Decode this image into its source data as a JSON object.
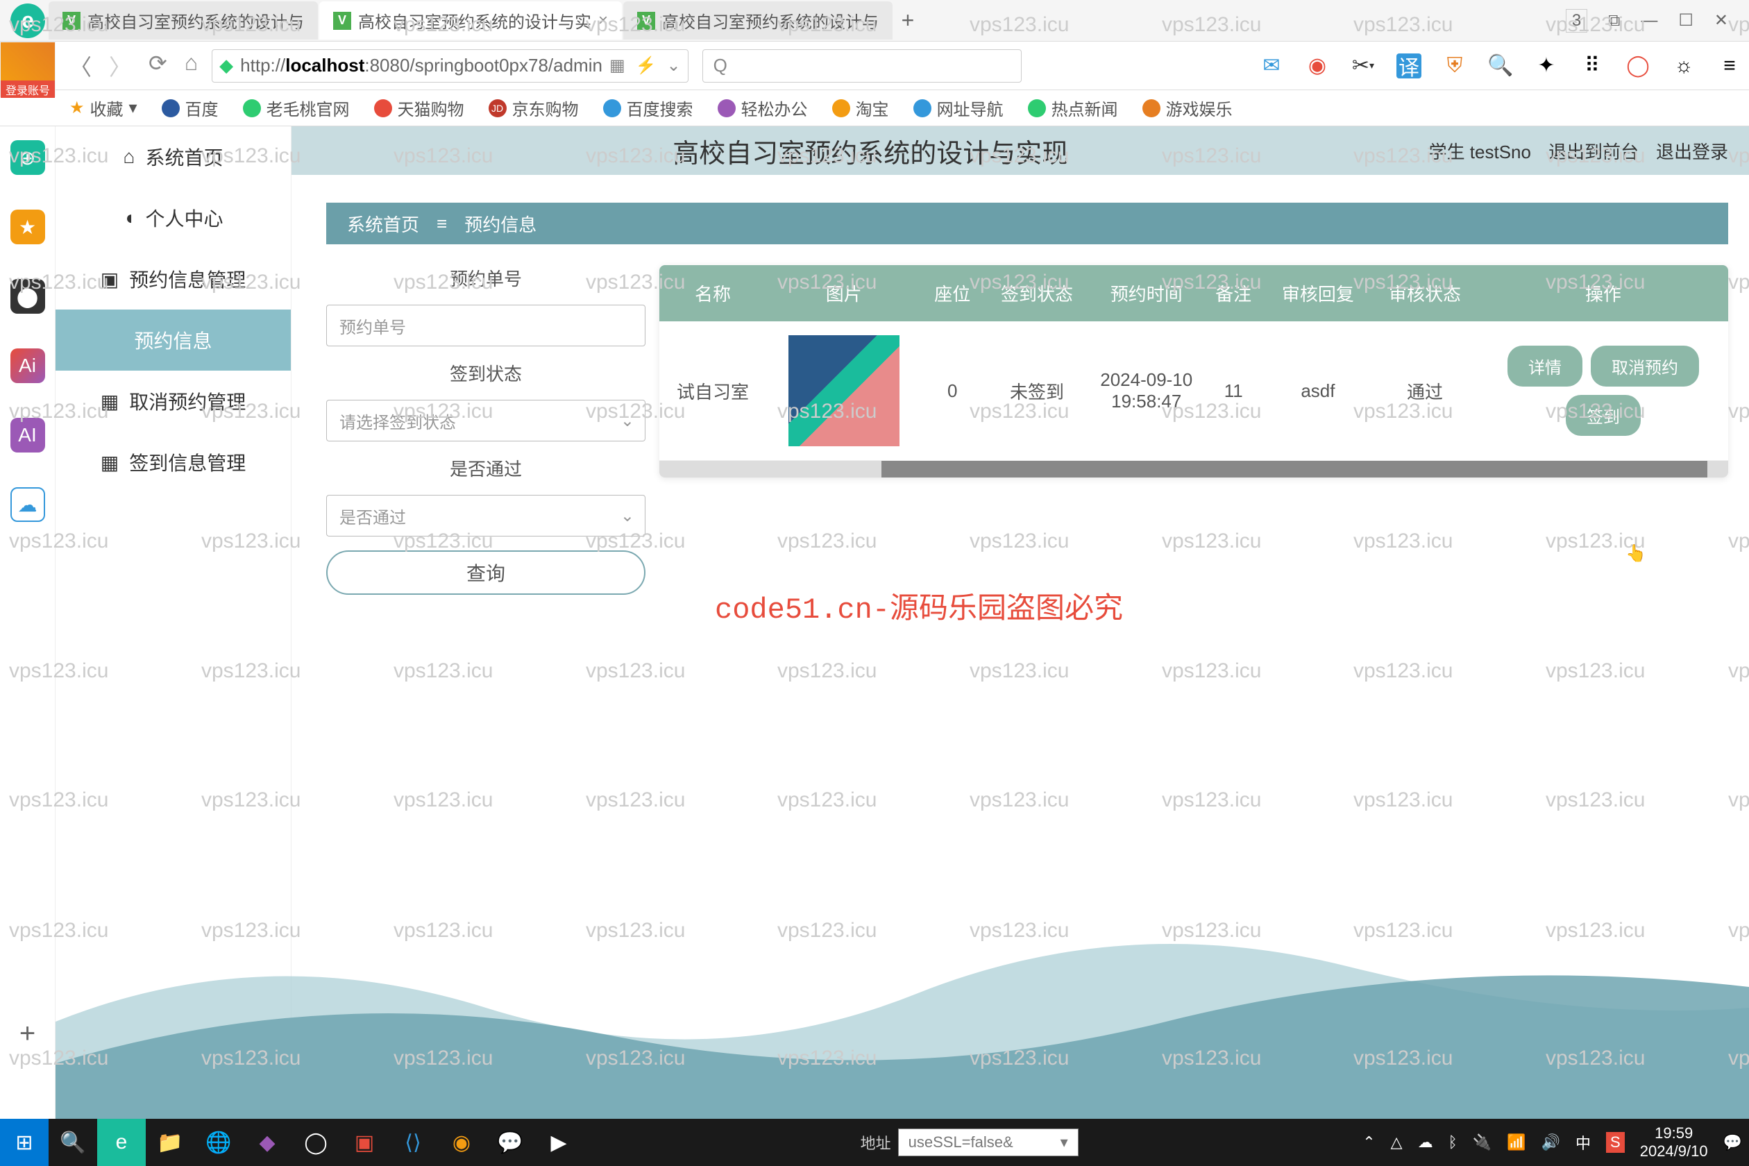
{
  "browser": {
    "tabs": [
      {
        "title": "高校自习室预约系统的设计与"
      },
      {
        "title": "高校自习室预约系统的设计与实"
      },
      {
        "title": "高校自习室预约系统的设计与"
      }
    ],
    "win_badge": "3",
    "url_prefix": "http://",
    "url_host": "localhost",
    "url_rest": ":8080/springboot0px78/admin",
    "login_label": "登录账号",
    "bookmarks": [
      {
        "label": "收藏"
      },
      {
        "label": "百度"
      },
      {
        "label": "老毛桃官网"
      },
      {
        "label": "天猫购物"
      },
      {
        "label": "京东购物"
      },
      {
        "label": "百度搜索"
      },
      {
        "label": "轻松办公"
      },
      {
        "label": "淘宝"
      },
      {
        "label": "网址导航"
      },
      {
        "label": "热点新闻"
      },
      {
        "label": "游戏娱乐"
      }
    ]
  },
  "sidebar": {
    "items": [
      {
        "icon": "home",
        "label": "系统首页"
      },
      {
        "icon": "person",
        "label": "个人中心"
      },
      {
        "icon": "inbox",
        "label": "预约信息管理"
      },
      {
        "icon": "doc",
        "label": "预约信息"
      },
      {
        "icon": "grid",
        "label": "取消预约管理"
      },
      {
        "icon": "grid",
        "label": "签到信息管理"
      }
    ]
  },
  "header": {
    "title": "高校自习室预约系统的设计与实现",
    "user": "学生 testSno",
    "to_front": "退出到前台",
    "logout": "退出登录"
  },
  "breadcrumb": {
    "home": "系统首页",
    "current": "预约信息"
  },
  "filters": {
    "order_label": "预约单号",
    "order_placeholder": "预约单号",
    "status_label": "签到状态",
    "status_placeholder": "请选择签到状态",
    "pass_label": "是否通过",
    "pass_placeholder": "是否通过",
    "query": "查询"
  },
  "table": {
    "headers": [
      "名称",
      "图片",
      "座位",
      "签到状态",
      "预约时间",
      "备注",
      "审核回复",
      "审核状态",
      "操作"
    ],
    "row": {
      "name": "试自习室",
      "seat": "0",
      "signin": "未签到",
      "time": "2024-09-10 19:58:47",
      "note": "11",
      "reply": "asdf",
      "audit": "通过"
    },
    "actions": {
      "detail": "详情",
      "cancel": "取消预约",
      "signin": "签到"
    }
  },
  "notice": "code51.cn-源码乐园盗图必究",
  "watermark": "vps123.icu",
  "taskbar": {
    "addr_label": "地址",
    "addr_value": "useSSL=false&",
    "time": "19:59",
    "date": "2024/9/10"
  }
}
